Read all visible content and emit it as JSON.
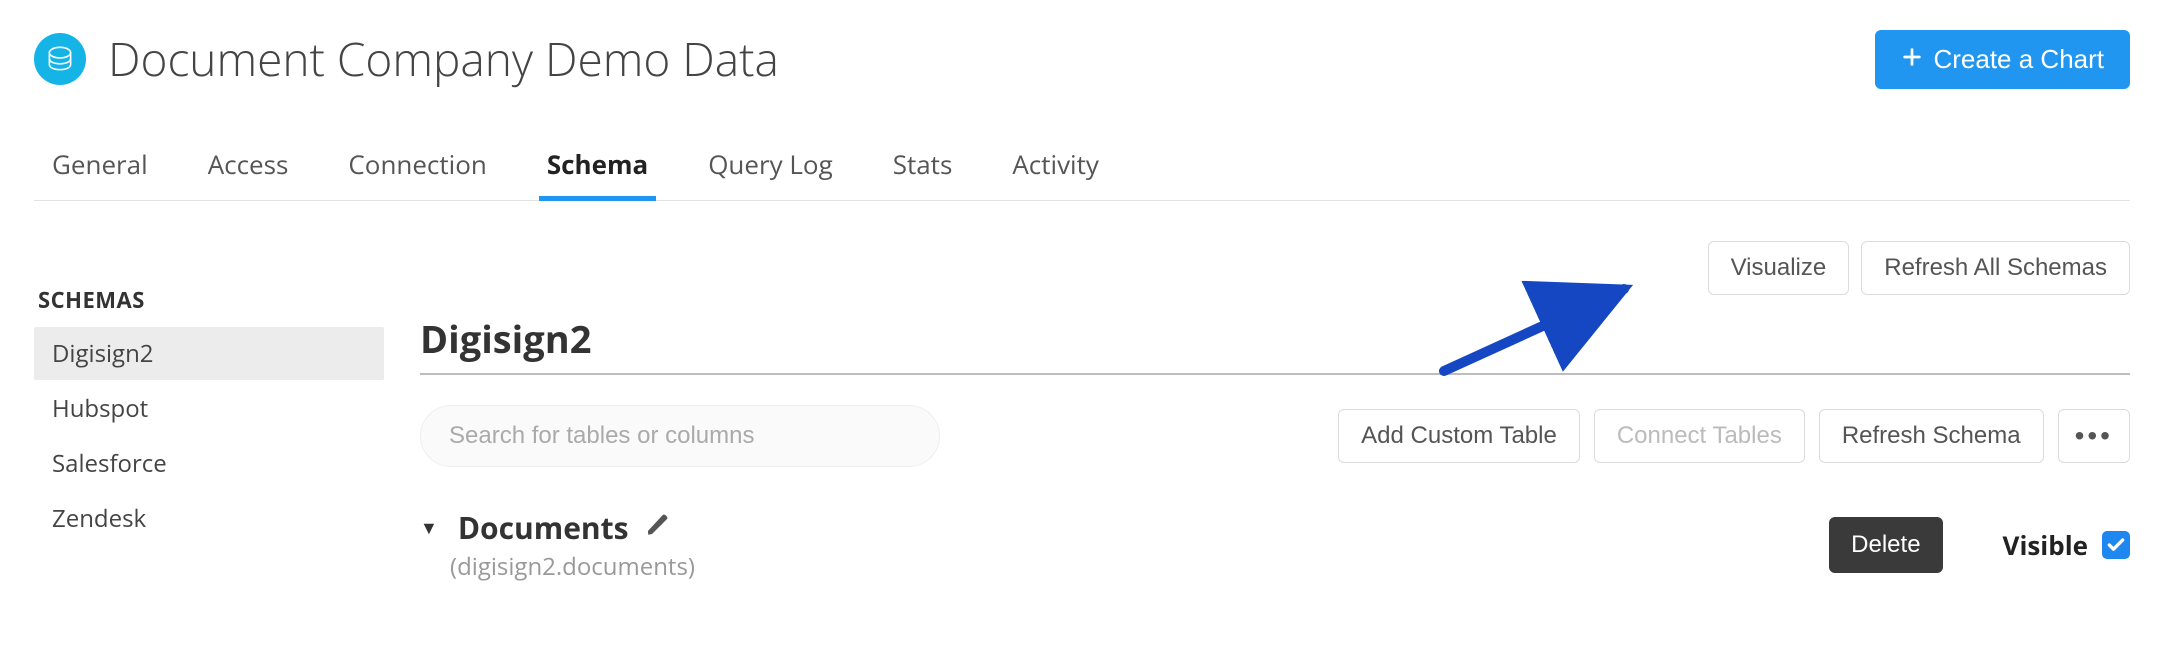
{
  "header": {
    "title": "Document Company Demo Data",
    "create_chart_label": "Create a Chart"
  },
  "tabs": [
    {
      "label": "General",
      "active": false
    },
    {
      "label": "Access",
      "active": false
    },
    {
      "label": "Connection",
      "active": false
    },
    {
      "label": "Schema",
      "active": true
    },
    {
      "label": "Query Log",
      "active": false
    },
    {
      "label": "Stats",
      "active": false
    },
    {
      "label": "Activity",
      "active": false
    }
  ],
  "sidebar": {
    "heading": "SCHEMAS",
    "items": [
      {
        "label": "Digisign2",
        "selected": true
      },
      {
        "label": "Hubspot",
        "selected": false
      },
      {
        "label": "Salesforce",
        "selected": false
      },
      {
        "label": "Zendesk",
        "selected": false
      }
    ]
  },
  "top_actions": {
    "visualize_label": "Visualize",
    "refresh_all_label": "Refresh All Schemas"
  },
  "schema": {
    "title": "Digisign2",
    "search_placeholder": "Search for tables or columns",
    "add_custom_table_label": "Add Custom Table",
    "connect_tables_label": "Connect Tables",
    "refresh_schema_label": "Refresh Schema",
    "more_label": "•••"
  },
  "table": {
    "name": "Documents",
    "qualified_name": "(digisign2.documents)",
    "delete_label": "Delete",
    "visible_label": "Visible",
    "visible_checked": true
  }
}
